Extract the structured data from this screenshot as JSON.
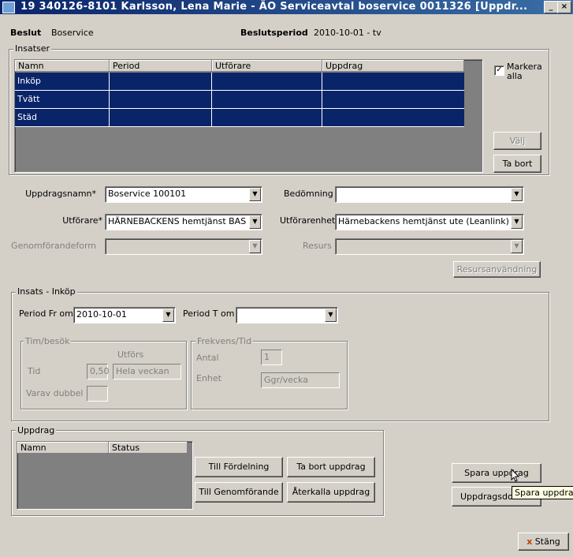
{
  "window": {
    "title": "19 340126-8101   Karlsson, Lena Marie   -  ÄO Serviceavtal boservice   0011326   [Uppdr..."
  },
  "header": {
    "beslut_label": "Beslut",
    "beslut_value": "Boservice",
    "beslutsperiod_label": "Beslutsperiod",
    "beslutsperiod_value": "2010-10-01 - tv"
  },
  "insatser": {
    "title": "Insatser",
    "columns": [
      "Namn",
      "Period",
      "Utförare",
      "Uppdrag"
    ],
    "rows": [
      {
        "namn": "Inköp",
        "period": "",
        "utforare": "",
        "uppdrag": ""
      },
      {
        "namn": "Tvätt",
        "period": "",
        "utforare": "",
        "uppdrag": ""
      },
      {
        "namn": "Städ",
        "period": "",
        "utforare": "",
        "uppdrag": ""
      }
    ],
    "markera_alla_line1": "Markera",
    "markera_alla_line2": "alla",
    "markera_alla_checked": true,
    "valj_label": "Välj",
    "ta_bort_label": "Ta bort"
  },
  "form": {
    "uppdragsnamn_label": "Uppdragsnamn*",
    "uppdragsnamn_value": "Boservice 100101",
    "bedomning_label": "Bedömning",
    "bedomning_value": "",
    "utforare_label": "Utförare*",
    "utforare_value": "HÄRNEBACKENS hemtjänst BAS (Lea",
    "utforarenhet_label": "Utförarenhet",
    "utforarenhet_value": "Härnebackens hemtjänst ute (Leanlink)",
    "genomforandeform_label": "Genomförandeform",
    "genomforandeform_value": "",
    "resurs_label": "Resurs",
    "resurs_value": "",
    "resursanvandning_label": "Resursanvändning"
  },
  "insats": {
    "title": "Insats - Inköp",
    "period_fr_label": "Period Fr om",
    "period_fr_value": "2010-10-01",
    "period_t_label": "Period T om",
    "period_t_value": "",
    "timbesok_title": "Tim/besök",
    "utfors_label": "Utförs",
    "tid_label": "Tid",
    "tid_value": "0,50",
    "tid_utfors_value": "Hela veckan",
    "varav_dubbel_label": "Varav dubbel",
    "varav_dubbel_value": "",
    "frekvens_title": "Frekvens/Tid",
    "antal_label": "Antal",
    "antal_value": "1",
    "enhet_label": "Enhet",
    "enhet_value": "Ggr/vecka"
  },
  "uppdrag": {
    "title": "Uppdrag",
    "columns": [
      "Namn",
      "Status"
    ],
    "till_fordelning": "Till Fördelning",
    "ta_bort_uppdrag": "Ta bort uppdrag",
    "till_genomforande": "Till Genomförande",
    "aterkalla_uppdrag": "Återkalla uppdrag"
  },
  "actions": {
    "spara_uppdrag": "Spara uppdrag",
    "uppdragsdokument": "Uppdragsdoku",
    "stang": "Stäng",
    "tooltip": "Spara uppdrag"
  },
  "colors": {
    "selection": "#0a246a",
    "face": "#d4d0c8",
    "titlebar": "#0a246a"
  },
  "icons": {
    "close": "close-icon",
    "stang": "x-icon",
    "cursor": "arrow-cursor-icon"
  }
}
